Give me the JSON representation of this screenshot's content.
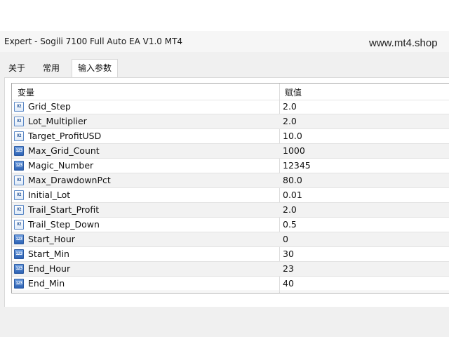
{
  "window": {
    "title": "Expert - Sogili 7100 Full Auto EA V1.0 MT4",
    "watermark": "www.mt4.shop"
  },
  "tabs": [
    {
      "label": "关于",
      "active": false
    },
    {
      "label": "常用",
      "active": false
    },
    {
      "label": "输入参数",
      "active": true
    }
  ],
  "table": {
    "columns": [
      "变量",
      "赋值"
    ],
    "rows": [
      {
        "icon": "double-value-icon",
        "badge": "V2",
        "name": "Grid_Step",
        "value": "2.0"
      },
      {
        "icon": "double-value-icon",
        "badge": "V2",
        "name": "Lot_Multiplier",
        "value": "2.0"
      },
      {
        "icon": "double-value-icon",
        "badge": "V2",
        "name": "Target_ProfitUSD",
        "value": "10.0"
      },
      {
        "icon": "integer-value-icon",
        "badge": "123",
        "name": "Max_Grid_Count",
        "value": "1000"
      },
      {
        "icon": "integer-value-icon",
        "badge": "123",
        "name": "Magic_Number",
        "value": "12345"
      },
      {
        "icon": "double-value-icon",
        "badge": "V2",
        "name": "Max_DrawdownPct",
        "value": "80.0"
      },
      {
        "icon": "double-value-icon",
        "badge": "V2",
        "name": "Initial_Lot",
        "value": "0.01"
      },
      {
        "icon": "double-value-icon",
        "badge": "V2",
        "name": "Trail_Start_Profit",
        "value": "2.0"
      },
      {
        "icon": "double-value-icon",
        "badge": "V2",
        "name": "Trail_Step_Down",
        "value": "0.5"
      },
      {
        "icon": "integer-value-icon",
        "badge": "123",
        "name": "Start_Hour",
        "value": "0"
      },
      {
        "icon": "integer-value-icon",
        "badge": "123",
        "name": "Start_Min",
        "value": "30"
      },
      {
        "icon": "integer-value-icon",
        "badge": "123",
        "name": "End_Hour",
        "value": "23"
      },
      {
        "icon": "integer-value-icon",
        "badge": "123",
        "name": "End_Min",
        "value": "40"
      }
    ]
  }
}
